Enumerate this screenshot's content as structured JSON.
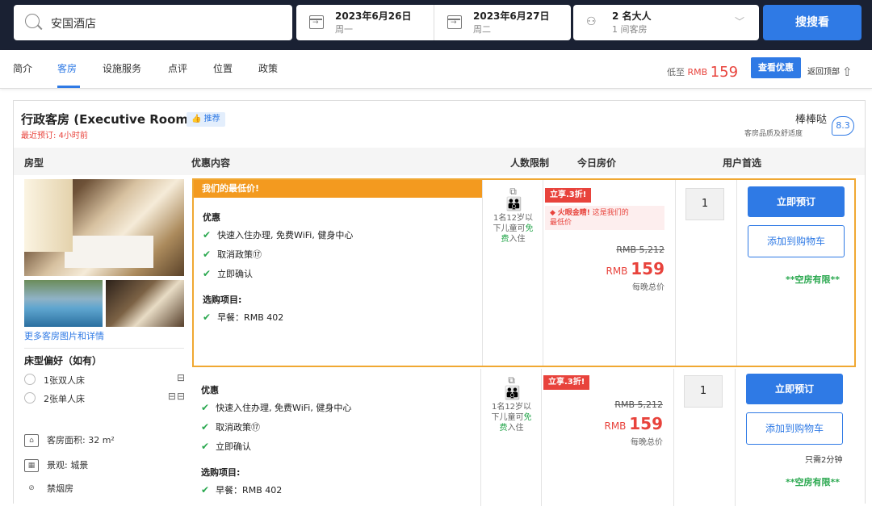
{
  "search": {
    "value": "安国酒店",
    "button": "搜搜看"
  },
  "checkin": {
    "date": "2023年6月26日",
    "day": "周一"
  },
  "checkout": {
    "date": "2023年6月27日",
    "day": "周二"
  },
  "guests": {
    "adults": "2 名大人",
    "rooms": "1 间客房"
  },
  "nav": {
    "tabs": [
      "简介",
      "客房",
      "设施服务",
      "点评",
      "位置",
      "政策"
    ],
    "active": "客房",
    "lowest_prefix": "低至",
    "lowest_currency": "RMB",
    "lowest_price": "159",
    "view_deal": "查看优惠",
    "back_top": "返回顶部"
  },
  "room": {
    "name": "行政客房 (Executive Room)",
    "recent": "最近预订: 4小时前",
    "recommend": "推荐",
    "rating_text": "棒棒哒",
    "rating_sub": "客房品质及舒适度",
    "rating": "8.3",
    "more_photos": "更多客房图片和详情",
    "bed_pref": "床型偏好（如有）",
    "beds": [
      "1张双人床",
      "2张单人床"
    ],
    "features": [
      "客房面积: 32 m²",
      "景观: 城景",
      "禁烟房"
    ]
  },
  "table_head": {
    "room_type": "房型",
    "deal": "优惠内容",
    "occupancy": "人数限制",
    "price": "今日房价",
    "user_pick": "用户首选"
  },
  "offers": [
    {
      "banner": "我们的最低价!",
      "perks_title": "优惠",
      "perks": [
        "快速入住办理, 免费WiFi, 健身中心",
        "取消政策⑰",
        "立即确认"
      ],
      "extras_title": "选购项目:",
      "extras": [
        "早餐：RMB 402"
      ],
      "occupancy_a": "1名12岁以",
      "occupancy_b": "下儿童可",
      "occupancy_c": "免",
      "occupancy_d": "费",
      "occupancy_e": "入住",
      "discount": "立享.3折!",
      "fire_label": "火眼金睛!",
      "fire_text": "这是我们的",
      "fire_text2": "最低价",
      "original": "RMB 5,212",
      "currency": "RMB",
      "price": "159",
      "per_night": "每晚总价",
      "qty": "1",
      "book": "立即预订",
      "cart": "添加到购物车",
      "limited": "**空房有限**"
    },
    {
      "perks_title": "优惠",
      "perks": [
        "快速入住办理, 免费WiFi, 健身中心",
        "取消政策⑰",
        "立即确认"
      ],
      "extras_title": "选购项目:",
      "extras": [
        "早餐：RMB 402"
      ],
      "occupancy_a": "1名12岁以",
      "occupancy_b": "下儿童可",
      "occupancy_c": "免",
      "occupancy_d": "费",
      "occupancy_e": "入住",
      "discount": "立享.3折!",
      "original": "RMB 5,212",
      "currency": "RMB",
      "price": "159",
      "per_night": "每晚总价",
      "qty": "1",
      "book": "立即预订",
      "cart": "添加到购物车",
      "fast": "只需2分钟",
      "limited": "**空房有限**"
    }
  ],
  "colors": {
    "topbar": "#1a2133",
    "accent": "#2f7ae5",
    "price": "#e8433c",
    "highlight": "#f39a1f",
    "check": "#2aa84f"
  }
}
